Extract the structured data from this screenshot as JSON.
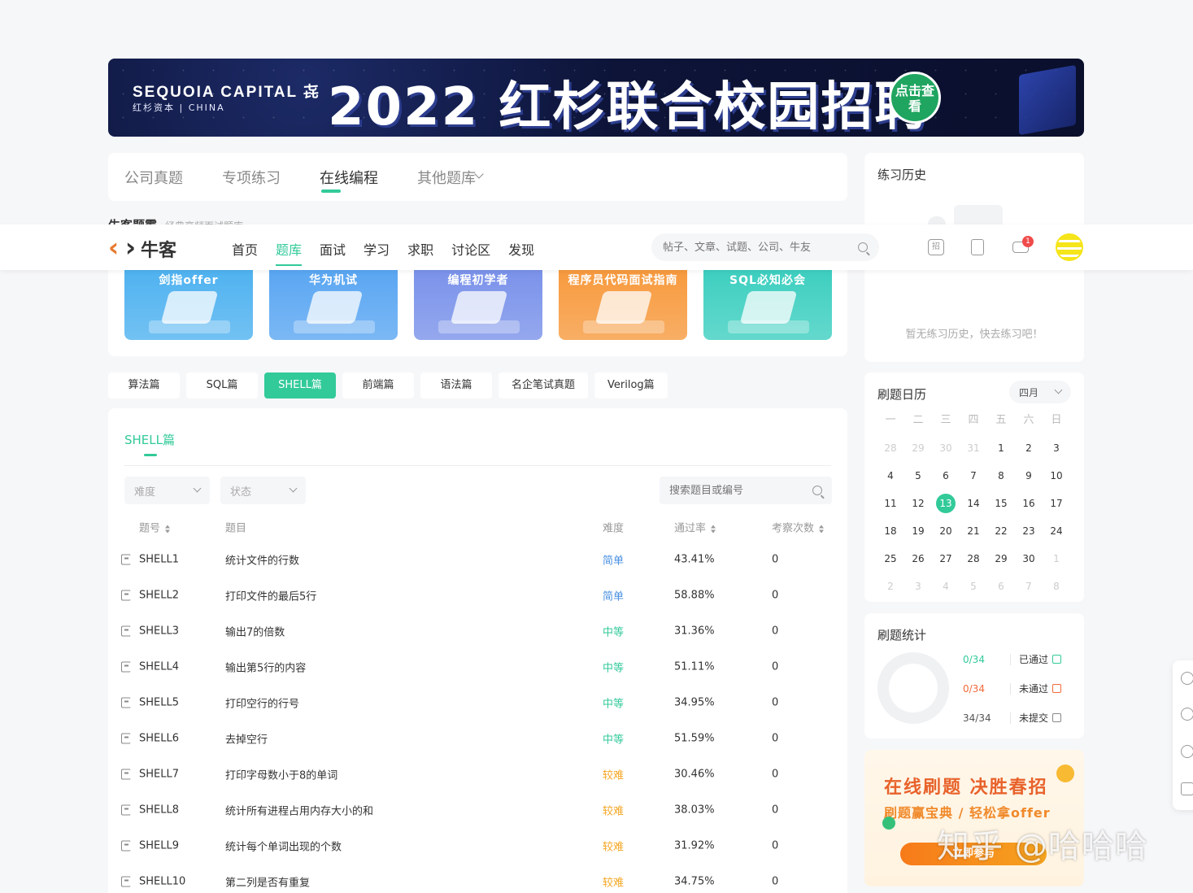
{
  "banner": {
    "brand": "SEQUOIA CAPITAL 㐂",
    "brand_sub": "红杉资本 | CHINA",
    "headline": "2022 红杉联合校园招聘",
    "cta": "点击查看"
  },
  "subnav": {
    "items": [
      "公司真题",
      "专项练习",
      "在线编程",
      "其他题库"
    ],
    "active": "在线编程"
  },
  "obscured_heading": {
    "title": "牛客题霸",
    "sub": "经典高频面试题库"
  },
  "header": {
    "logo_text": "牛客",
    "nav": [
      "首页",
      "题库",
      "面试",
      "学习",
      "求职",
      "讨论区",
      "发现"
    ],
    "active": "题库",
    "search_placeholder": "帖子、文章、试题、公司、牛友",
    "recruit_icon_label": "招",
    "message_badge": "1"
  },
  "books": [
    {
      "title": "剑指offer",
      "color": "#4fb2f0"
    },
    {
      "title": "华为机试",
      "color": "#5aa6f2"
    },
    {
      "title": "编程初学者",
      "color": "#7a92ea"
    },
    {
      "title": "程序员代码面试指南",
      "color": "#f79a3e"
    },
    {
      "title": "SQL必知必会",
      "color": "#3dcfc0"
    }
  ],
  "categories": {
    "items": [
      "算法篇",
      "SQL篇",
      "SHELL篇",
      "前端篇",
      "语法篇",
      "名企笔试真题",
      "Verilog篇"
    ],
    "active": "SHELL篇"
  },
  "list": {
    "title": "SHELL篇",
    "filters": {
      "difficulty": "难度",
      "status": "状态"
    },
    "search_placeholder": "搜索题目或编号",
    "headers": {
      "id": "题号",
      "title": "题目",
      "difficulty": "难度",
      "pass_rate": "通过率",
      "count": "考察次数"
    },
    "rows": [
      {
        "id": "SHELL1",
        "title": "统计文件的行数",
        "difficulty": "简单",
        "level": "easy",
        "pass_rate": "43.41%",
        "count": "0"
      },
      {
        "id": "SHELL2",
        "title": "打印文件的最后5行",
        "difficulty": "简单",
        "level": "easy",
        "pass_rate": "58.88%",
        "count": "0"
      },
      {
        "id": "SHELL3",
        "title": "输出7的倍数",
        "difficulty": "中等",
        "level": "mid",
        "pass_rate": "31.36%",
        "count": "0"
      },
      {
        "id": "SHELL4",
        "title": "输出第5行的内容",
        "difficulty": "中等",
        "level": "mid",
        "pass_rate": "51.11%",
        "count": "0"
      },
      {
        "id": "SHELL5",
        "title": "打印空行的行号",
        "difficulty": "中等",
        "level": "mid",
        "pass_rate": "34.95%",
        "count": "0"
      },
      {
        "id": "SHELL6",
        "title": "去掉空行",
        "difficulty": "中等",
        "level": "mid",
        "pass_rate": "51.59%",
        "count": "0"
      },
      {
        "id": "SHELL7",
        "title": "打印字母数小于8的单词",
        "difficulty": "较难",
        "level": "hard",
        "pass_rate": "30.46%",
        "count": "0"
      },
      {
        "id": "SHELL8",
        "title": "统计所有进程占用内存大小的和",
        "difficulty": "较难",
        "level": "hard",
        "pass_rate": "38.03%",
        "count": "0"
      },
      {
        "id": "SHELL9",
        "title": "统计每个单词出现的个数",
        "difficulty": "较难",
        "level": "hard",
        "pass_rate": "31.92%",
        "count": "0"
      },
      {
        "id": "SHELL10",
        "title": "第二列是否有重复",
        "difficulty": "较难",
        "level": "hard",
        "pass_rate": "34.75%",
        "count": "0"
      }
    ]
  },
  "history": {
    "title": "练习历史",
    "empty_text": "暂无练习历史，快去练习吧！"
  },
  "calendar": {
    "title": "刷题日历",
    "month": "四月",
    "weekdays": [
      "一",
      "二",
      "三",
      "四",
      "五",
      "六",
      "日"
    ],
    "days": [
      [
        "28",
        "dim"
      ],
      [
        "29",
        "dim"
      ],
      [
        "30",
        "dim"
      ],
      [
        "31",
        "dim"
      ],
      [
        "1",
        ""
      ],
      [
        "2",
        ""
      ],
      [
        "3",
        ""
      ],
      [
        "4",
        ""
      ],
      [
        "5",
        ""
      ],
      [
        "6",
        ""
      ],
      [
        "7",
        ""
      ],
      [
        "8",
        ""
      ],
      [
        "9",
        ""
      ],
      [
        "10",
        ""
      ],
      [
        "11",
        ""
      ],
      [
        "12",
        ""
      ],
      [
        "13",
        "today"
      ],
      [
        "14",
        ""
      ],
      [
        "15",
        ""
      ],
      [
        "16",
        ""
      ],
      [
        "17",
        ""
      ],
      [
        "18",
        ""
      ],
      [
        "19",
        ""
      ],
      [
        "20",
        ""
      ],
      [
        "21",
        ""
      ],
      [
        "22",
        ""
      ],
      [
        "23",
        ""
      ],
      [
        "24",
        ""
      ],
      [
        "25",
        ""
      ],
      [
        "26",
        ""
      ],
      [
        "27",
        ""
      ],
      [
        "28",
        ""
      ],
      [
        "29",
        ""
      ],
      [
        "30",
        ""
      ],
      [
        "1",
        "dim"
      ],
      [
        "2",
        "dim"
      ],
      [
        "3",
        "dim"
      ],
      [
        "4",
        "dim"
      ],
      [
        "5",
        "dim"
      ],
      [
        "6",
        "dim"
      ],
      [
        "7",
        "dim"
      ],
      [
        "8",
        "dim"
      ]
    ]
  },
  "stats": {
    "title": "刷题统计",
    "rows": [
      {
        "value": "0/34",
        "label": "已通过",
        "color": "#32ca99"
      },
      {
        "value": "0/34",
        "label": "未通过",
        "color": "#f06a3a"
      },
      {
        "value": "34/34",
        "label": "未提交",
        "color": "#888888"
      }
    ]
  },
  "promo": {
    "headline": "在线刷题 决胜春招",
    "sub": "刷题赢宝典 / 轻松拿offer",
    "button": "立即参与"
  },
  "watermark": "知乎 @哈哈哈",
  "colors": {
    "accent": "#32ca99",
    "easy": "#4a90e2",
    "mid": "#32ca99",
    "hard": "#f5a623"
  }
}
